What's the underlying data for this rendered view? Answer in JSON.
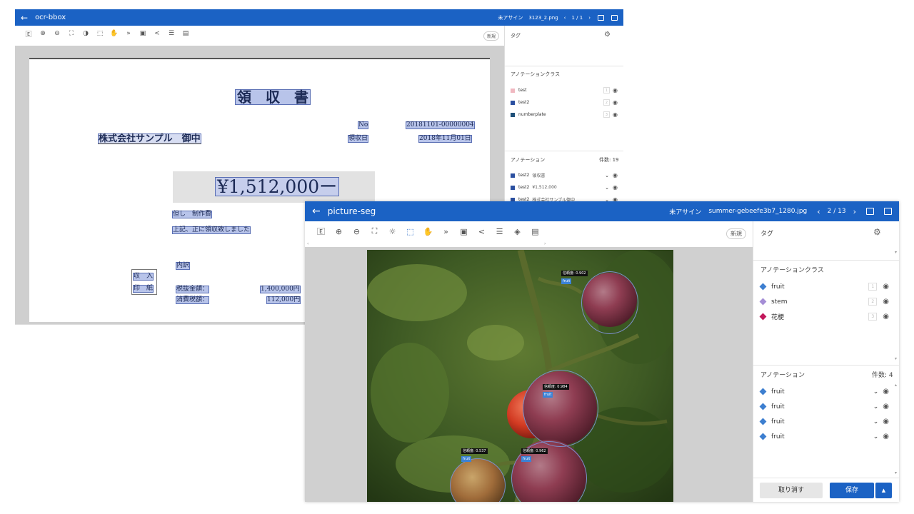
{
  "window1": {
    "title": "ocr-bbox",
    "assignee": "未アサイン",
    "filename": "3123_2.png",
    "pager": "1 / 1",
    "new_label": "新規",
    "tag_title": "タグ",
    "class_title": "アノテーションクラス",
    "classes": [
      {
        "name": "test",
        "key": "1",
        "color": "#f0b8c0"
      },
      {
        "name": "test2",
        "key": "2",
        "color": "#2a4fa0"
      },
      {
        "name": "numberplate",
        "key": "3",
        "color": "#1e4f78"
      }
    ],
    "annotation_title": "アノテーション",
    "count": "件数: 19",
    "annotations": [
      {
        "cls": "test2",
        "text": "領収書"
      },
      {
        "cls": "test2",
        "text": "¥1,512,000"
      },
      {
        "cls": "test2",
        "text": "株式会社サンプル御中"
      },
      {
        "cls": "test2",
        "text": "但し 制作費"
      }
    ],
    "receipt": {
      "title": "領　収　書",
      "no_label": "No",
      "no_value": "20181101-00000004",
      "date_label": "領収日",
      "date_value": "2018年11月01日",
      "company": "株式会社サンプル　御中",
      "amount": "¥1,512,000ー",
      "memo1": "但し　制作費",
      "memo2": "上記、正に領収致しました",
      "breakdown": "内訳",
      "stamp1": "収　入",
      "stamp2": "印　紙",
      "tax_ex_label": "税抜金額：",
      "tax_ex_value": "1,400,000円",
      "tax_label": "消費税額：",
      "tax_value": "112,000円"
    }
  },
  "window2": {
    "title": "picture-seg",
    "assignee": "未アサイン",
    "filename": "summer-gebeefe3b7_1280.jpg",
    "pager": "2 / 13",
    "new_label": "新規",
    "tag_title": "タグ",
    "class_title": "アノテーションクラス",
    "classes": [
      {
        "name": "fruit",
        "key": "1",
        "color": "#3d7fd0"
      },
      {
        "name": "stem",
        "key": "2",
        "color": "#a58ed6"
      },
      {
        "name": "花梗",
        "key": "3",
        "color": "#c2185b"
      }
    ],
    "annotation_title": "アノテーション",
    "count": "件数: 4",
    "annotations": [
      {
        "cls": "fruit",
        "color": "#3d7fd0"
      },
      {
        "cls": "fruit",
        "color": "#3d7fd0"
      },
      {
        "cls": "fruit",
        "color": "#3d7fd0"
      },
      {
        "cls": "fruit",
        "color": "#3d7fd0"
      }
    ],
    "labels": [
      {
        "conf": "信頼度: 0.902",
        "cls": "fruit"
      },
      {
        "conf": "信頼度: 0.984",
        "cls": "fruit"
      },
      {
        "conf": "信頼度: 0.537",
        "cls": "fruit"
      },
      {
        "conf": "信頼度: 0.962",
        "cls": "fruit"
      }
    ],
    "cancel_label": "取り消す",
    "save_label": "保存"
  },
  "colors": {
    "accent": "#1b62c4",
    "bbox_fill": "#b8c4ea"
  }
}
